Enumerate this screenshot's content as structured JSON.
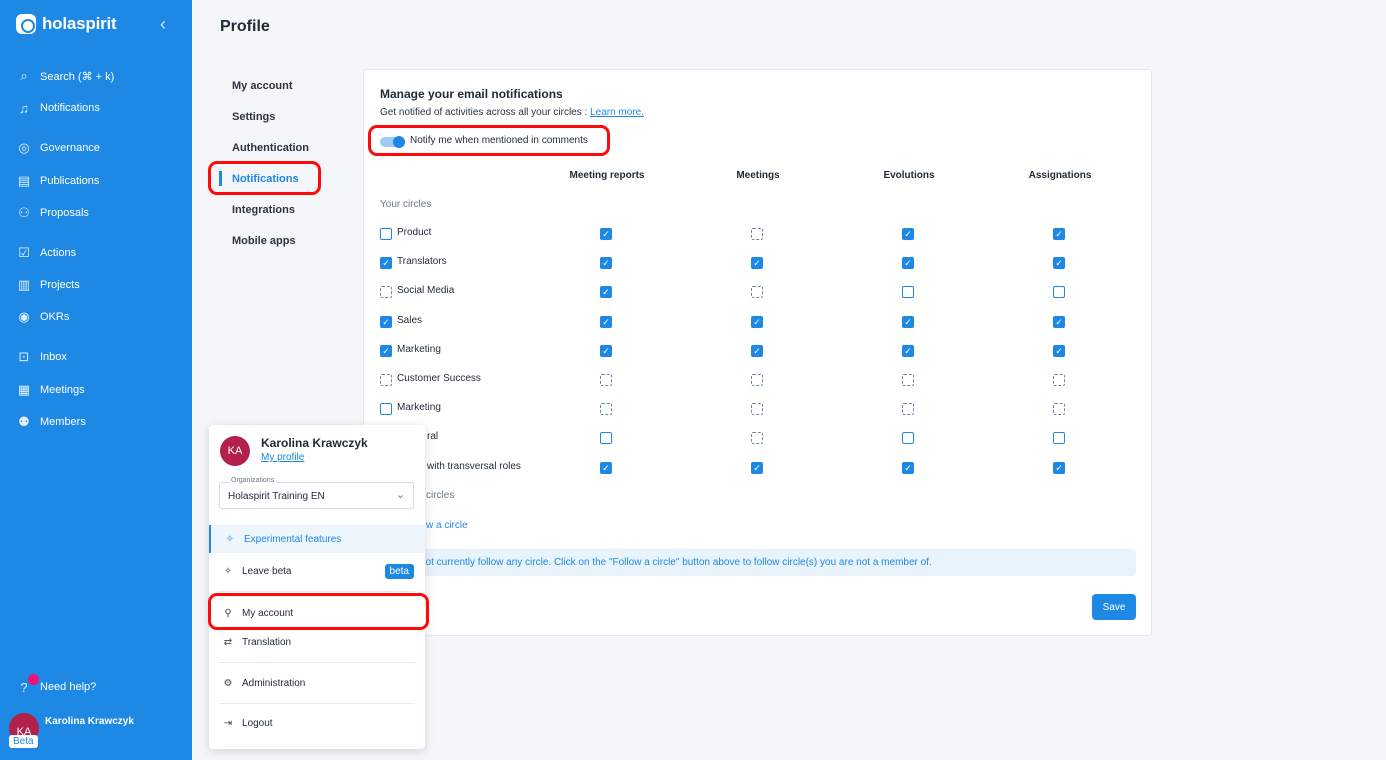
{
  "sidebar": {
    "brand": "holaspirit",
    "items": [
      {
        "label": "Search  (⌘ + k)",
        "icon": "search-icon"
      },
      {
        "label": "Notifications",
        "icon": "bell-icon"
      },
      {
        "label": "Governance",
        "icon": "governance-icon"
      },
      {
        "label": "Publications",
        "icon": "document-icon"
      },
      {
        "label": "Proposals",
        "icon": "proposals-icon"
      },
      {
        "label": "Actions",
        "icon": "checklist-icon"
      },
      {
        "label": "Projects",
        "icon": "kanban-icon"
      },
      {
        "label": "OKRs",
        "icon": "target-icon"
      },
      {
        "label": "Inbox",
        "icon": "inbox-icon"
      },
      {
        "label": "Meetings",
        "icon": "calendar-icon"
      },
      {
        "label": "Members",
        "icon": "members-icon"
      }
    ],
    "help_label": "Need help?",
    "user_name": "Karolina Krawczyk",
    "user_initials": "KA",
    "beta_label": "Beta"
  },
  "page": {
    "title": "Profile",
    "subnav": [
      "My account",
      "Settings",
      "Authentication",
      "Notifications",
      "Integrations",
      "Mobile apps"
    ]
  },
  "notifications": {
    "heading": "Manage your email notifications",
    "subtitle": "Get notified of activities across all your circles : ",
    "learn_more": "Learn more.",
    "toggle_label": "Notify me when mentioned in comments",
    "columns": [
      "Meeting reports",
      "Meetings",
      "Evolutions",
      "Assignations"
    ],
    "section_your_circles": "Your circles",
    "rows": [
      {
        "label": "Product",
        "row_state": "off",
        "cells": [
          "on",
          "dis",
          "on",
          "on"
        ]
      },
      {
        "label": "Translators",
        "row_state": "on",
        "cells": [
          "on",
          "on",
          "on",
          "on"
        ]
      },
      {
        "label": "Social Media",
        "row_state": "dis",
        "cells": [
          "on",
          "dis",
          "off",
          "off"
        ]
      },
      {
        "label": "Sales",
        "row_state": "on",
        "cells": [
          "on",
          "on",
          "on",
          "on"
        ]
      },
      {
        "label": "Marketing",
        "row_state": "on",
        "cells": [
          "on",
          "on",
          "on",
          "on"
        ]
      },
      {
        "label": "Customer Success",
        "row_state": "dis",
        "cells": [
          "dis",
          "dis",
          "dis",
          "dis"
        ]
      },
      {
        "label": "Marketing",
        "row_state": "off",
        "cells": [
          "dis",
          "dis",
          "dis",
          "dis"
        ]
      },
      {
        "label": "ral",
        "row_state": "",
        "cells": [
          "off",
          "dis",
          "off",
          "off"
        ]
      },
      {
        "label": "with transversal roles",
        "row_state": "",
        "cells": [
          "on",
          "on",
          "on",
          "on"
        ]
      }
    ],
    "section_followed": "circles",
    "follow_link": "w a circle",
    "info_text": "not currently follow any circle. Click on the \"Follow a circle\" button above to follow circle(s) you are not a member of.",
    "save_label": "Save"
  },
  "popup": {
    "name": "Karolina Krawczyk",
    "initials": "KA",
    "profile_link": "My profile",
    "org_legend": "Organizations",
    "org_value": "Holaspirit Training EN",
    "items": {
      "experimental": "Experimental features",
      "leave_beta": "Leave beta",
      "beta_badge": "beta",
      "my_account": "My account",
      "translation": "Translation",
      "administration": "Administration",
      "logout": "Logout"
    }
  },
  "colors": {
    "accent": "#1e88e5",
    "highlight": "#ff0a0a",
    "avatar": "#b3204c"
  }
}
